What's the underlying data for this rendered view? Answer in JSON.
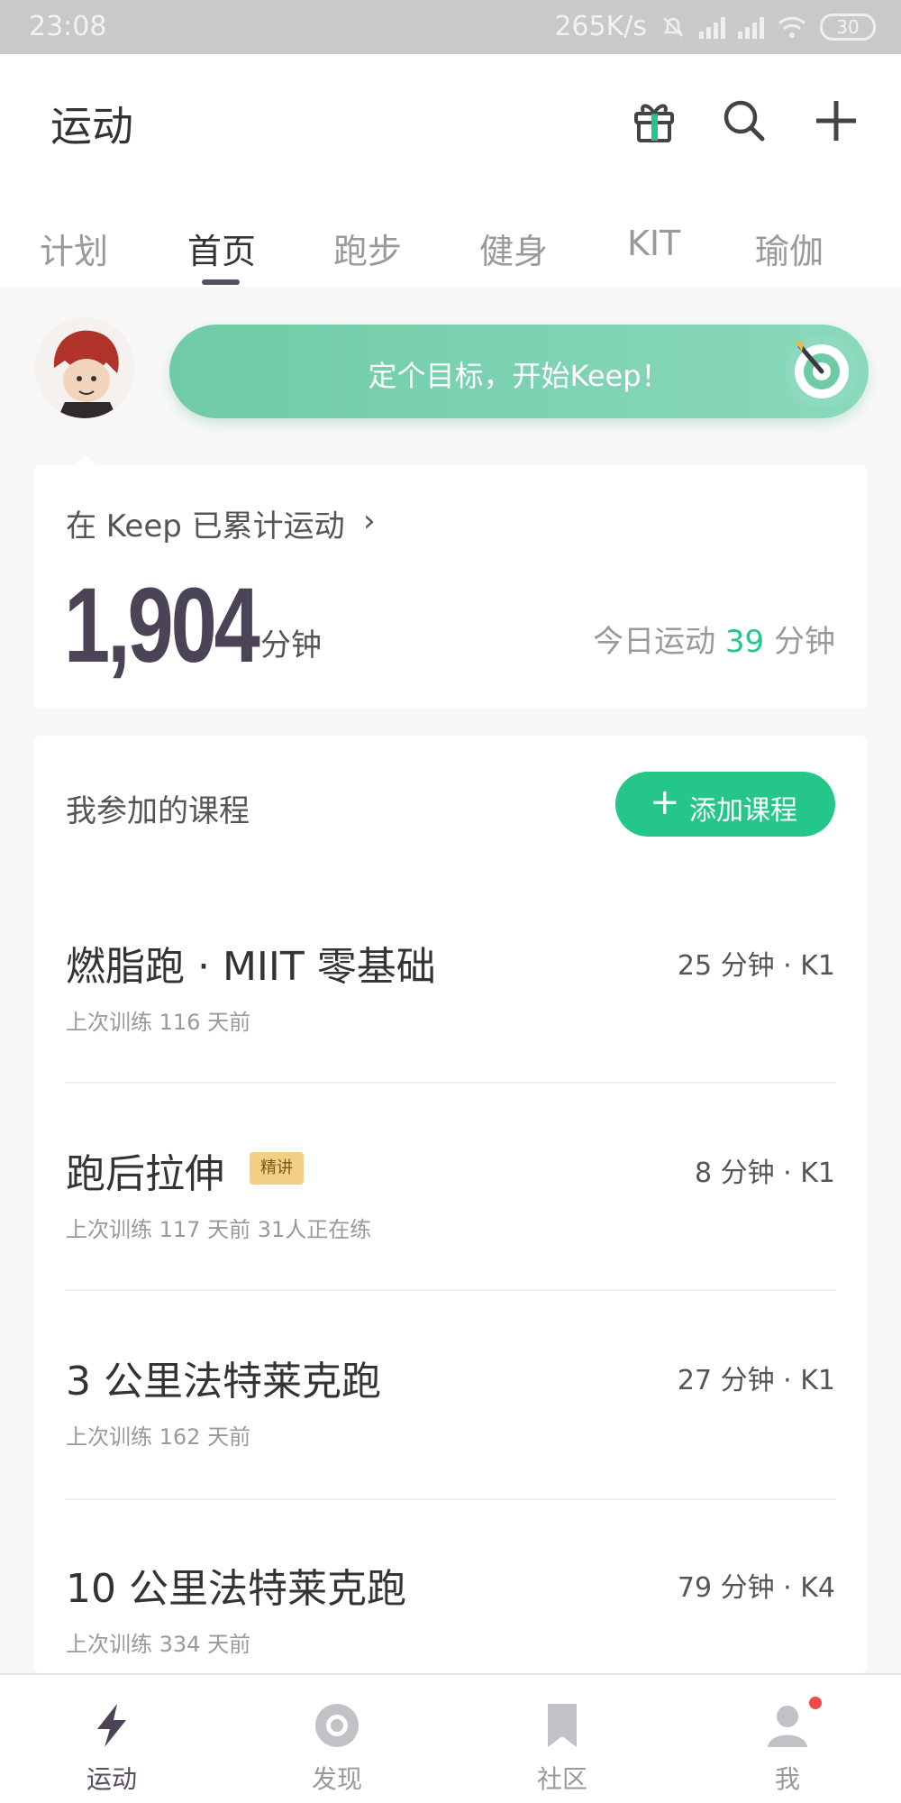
{
  "status_bar": {
    "time": "23:08",
    "network_speed": "265K/s",
    "battery": "30"
  },
  "header": {
    "title": "运动"
  },
  "tabs": [
    {
      "label": "计划"
    },
    {
      "label": "首页"
    },
    {
      "label": "跑步"
    },
    {
      "label": "健身"
    },
    {
      "label": "KIT"
    },
    {
      "label": "瑜伽"
    }
  ],
  "active_tab": "首页",
  "goal": {
    "text": "定个目标，开始Keep！"
  },
  "summary": {
    "label": "在 Keep 已累计运动",
    "total": "1,904",
    "unit": "分钟",
    "today_prefix": "今日运动",
    "today_value": "39",
    "today_unit": "分钟"
  },
  "courses_section": {
    "title": "我参加的课程",
    "add_button": "添加课程",
    "items": [
      {
        "name": "燃脂跑 · MIIT 零基础",
        "meta": "25 分钟 · K1",
        "sub": "上次训练 116 天前",
        "badge": ""
      },
      {
        "name": "跑后拉伸",
        "meta": "8 分钟 · K1",
        "sub": "上次训练 117 天前  31人正在练",
        "badge": "精讲"
      },
      {
        "name": "3 公里法特莱克跑",
        "meta": "27 分钟 · K1",
        "sub": "上次训练 162 天前",
        "badge": ""
      },
      {
        "name": "10 公里法特莱克跑",
        "meta": "79 分钟 · K4",
        "sub": "上次训练 334 天前",
        "badge": ""
      }
    ]
  },
  "bottom_nav": [
    {
      "label": "运动",
      "icon": "lightning-icon"
    },
    {
      "label": "发现",
      "icon": "discover-icon"
    },
    {
      "label": "社区",
      "icon": "bookmark-icon"
    },
    {
      "label": "我",
      "icon": "profile-icon"
    }
  ],
  "colors": {
    "accent_green": "#24c789",
    "goal_gradient_start": "#6fcba6",
    "primary_text": "#4a4456",
    "notification_dot": "#f2494a"
  }
}
